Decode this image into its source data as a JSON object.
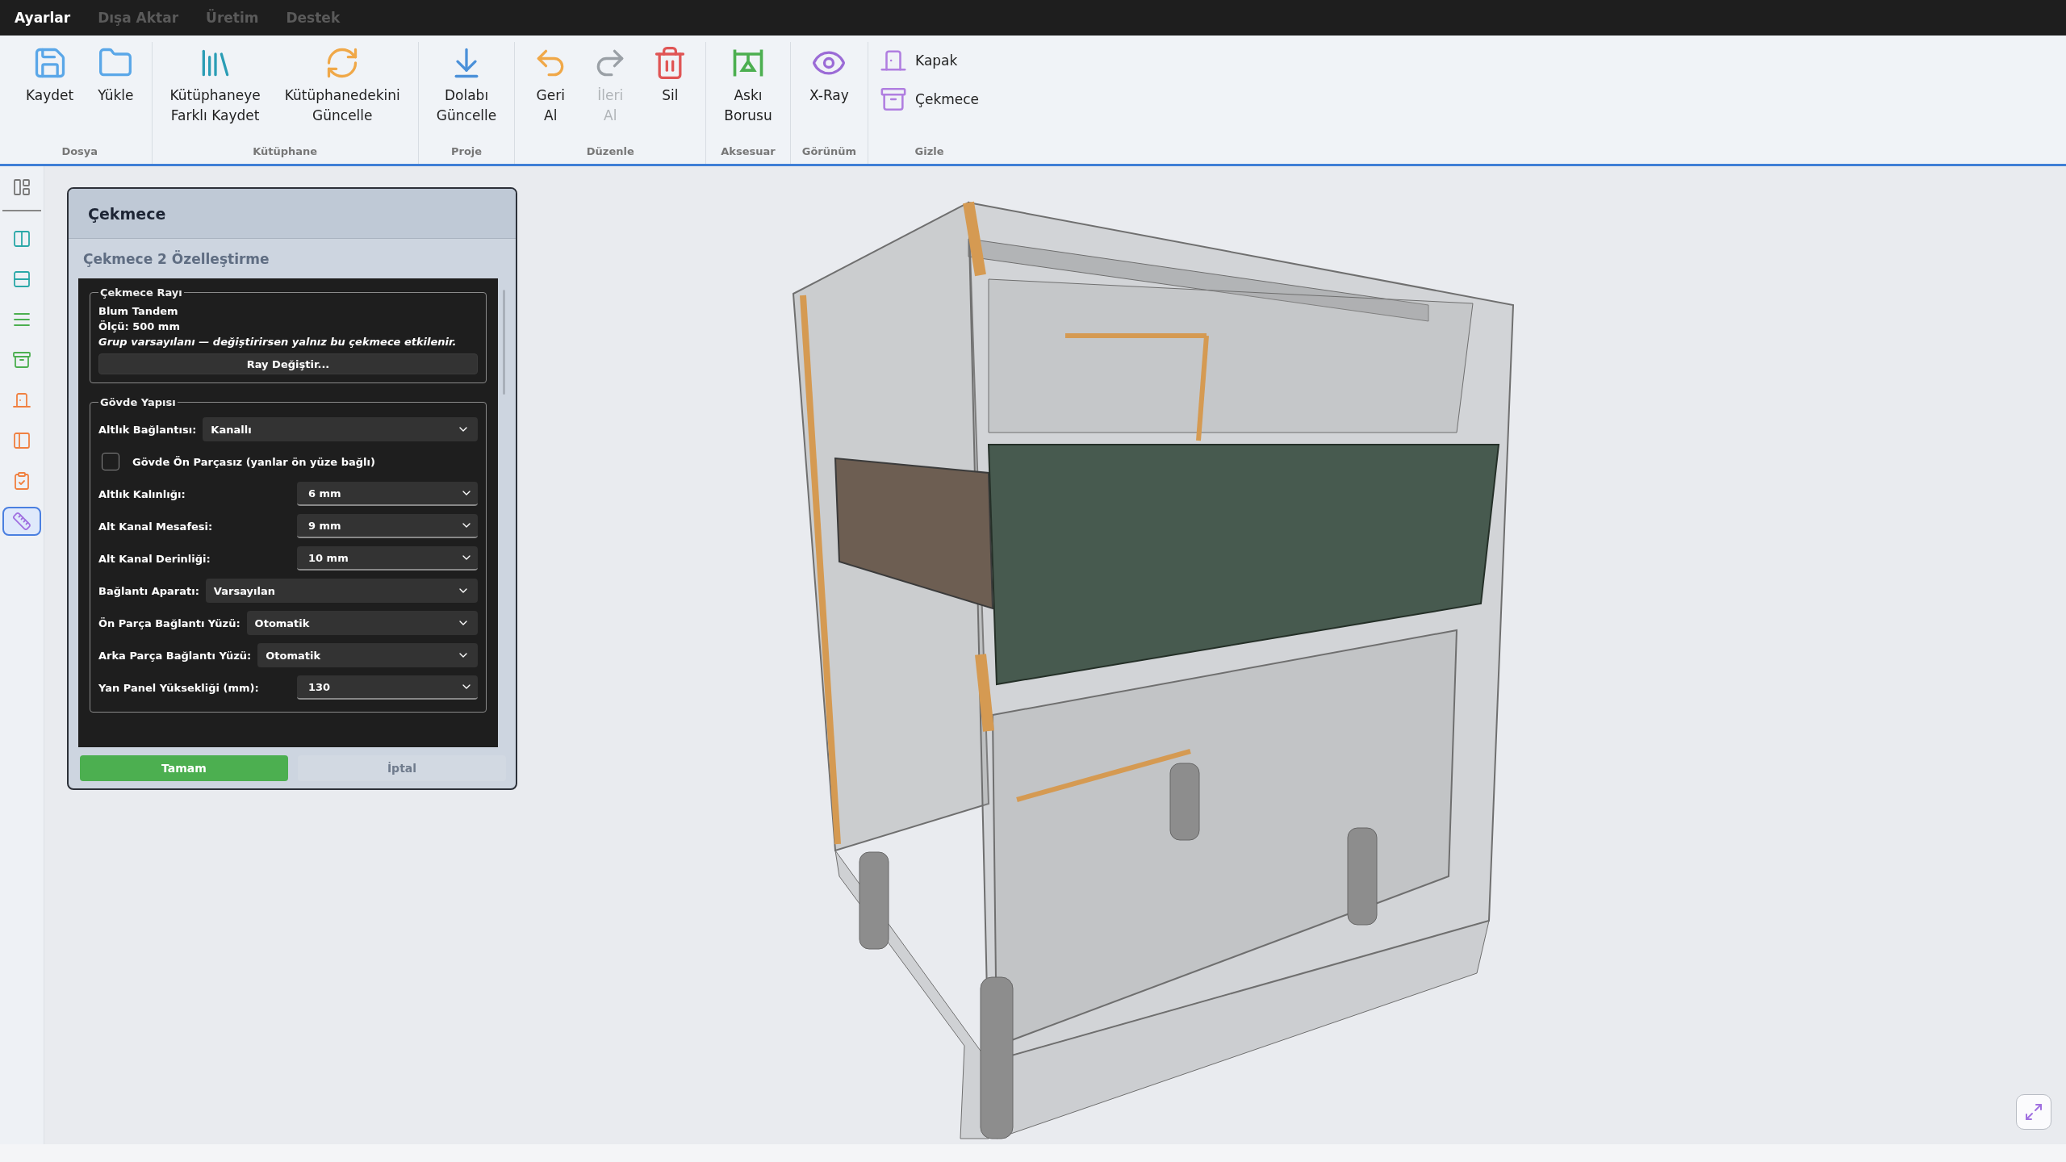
{
  "menu": [
    {
      "label": "Ayarlar",
      "selected": true
    },
    {
      "label": "Dışa Aktar",
      "selected": false
    },
    {
      "label": "Üretim",
      "selected": false
    },
    {
      "label": "Destek",
      "selected": false
    }
  ],
  "ribbon": [
    {
      "group": "Dosya",
      "items": [
        {
          "lines": [
            "Kaydet"
          ],
          "kind": "large",
          "disabled": false
        },
        {
          "lines": [
            "Yükle"
          ],
          "kind": "large",
          "disabled": false
        }
      ]
    },
    {
      "group": "Kütüphane",
      "items": [
        {
          "lines": [
            "Kütüphaneye",
            "Farklı Kaydet"
          ],
          "kind": "large",
          "disabled": false
        },
        {
          "lines": [
            "Kütüphanedekini",
            "Güncelle"
          ],
          "kind": "large",
          "disabled": false
        }
      ]
    },
    {
      "group": "Proje",
      "items": [
        {
          "lines": [
            "Dolabı",
            "Güncelle"
          ],
          "kind": "large",
          "disabled": false
        }
      ]
    },
    {
      "group": "Düzenle",
      "items": [
        {
          "lines": [
            "Geri",
            "Al"
          ],
          "kind": "large",
          "disabled": false
        },
        {
          "lines": [
            "İleri",
            "Al"
          ],
          "kind": "large",
          "disabled": true
        },
        {
          "lines": [
            "Sil"
          ],
          "kind": "large",
          "disabled": false
        }
      ]
    },
    {
      "group": "Aksesuar",
      "items": [
        {
          "lines": [
            "Askı",
            "Borusu"
          ],
          "kind": "large",
          "disabled": false
        }
      ]
    },
    {
      "group": "Görünüm",
      "items": [
        {
          "lines": [
            "X-Ray"
          ],
          "kind": "large",
          "disabled": false
        }
      ]
    },
    {
      "group": "Gizle",
      "items": [
        {
          "lines": [
            "Kapak"
          ],
          "kind": "small",
          "disabled": false
        },
        {
          "lines": [
            "Çekmece"
          ],
          "kind": "small",
          "disabled": false
        }
      ]
    }
  ],
  "sidebar": {
    "items": [
      {
        "selected": false
      },
      {
        "selected": false
      },
      {
        "selected": false
      },
      {
        "selected": false
      },
      {
        "selected": false
      },
      {
        "selected": false
      },
      {
        "selected": false
      },
      {
        "selected": false
      },
      {
        "selected": true
      }
    ]
  },
  "dialog": {
    "title": "Çekmece",
    "subtitle": "Çekmece 2 Özelleştirme",
    "rail": {
      "legend": "Çekmece Rayı",
      "name": "Blum Tandem",
      "size": "Ölçü: 500 mm",
      "note": "Grup varsayılanı — değiştirirsen yalnız bu çekmece etkilenir.",
      "button": "Ray Değiştir..."
    },
    "body": {
      "legend": "Gövde Yapısı",
      "fields": [
        {
          "kind": "select",
          "label": "Altlık Bağlantısı:",
          "value": "Kanallı"
        },
        {
          "kind": "checkbox",
          "label": "Gövde Ön Parçasız (yanlar ön yüze bağlı)",
          "checked": false
        },
        {
          "kind": "spin",
          "label": "Altlık Kalınlığı:",
          "value": "6 mm"
        },
        {
          "kind": "spin",
          "label": "Alt Kanal Mesafesi:",
          "value": "9 mm"
        },
        {
          "kind": "spin",
          "label": "Alt Kanal Derinliği:",
          "value": "10 mm"
        },
        {
          "kind": "select",
          "label": "Bağlantı Aparatı:",
          "value": "Varsayılan"
        },
        {
          "kind": "select",
          "label": "Ön Parça Bağlantı Yüzü:",
          "value": "Otomatik"
        },
        {
          "kind": "select",
          "label": "Arka Parça Bağlantı Yüzü:",
          "value": "Otomatik"
        },
        {
          "kind": "spin",
          "label": "Yan Panel Yüksekliği (mm):",
          "value": "130"
        }
      ]
    },
    "ok": "Tamam",
    "cancel": "İptal"
  }
}
